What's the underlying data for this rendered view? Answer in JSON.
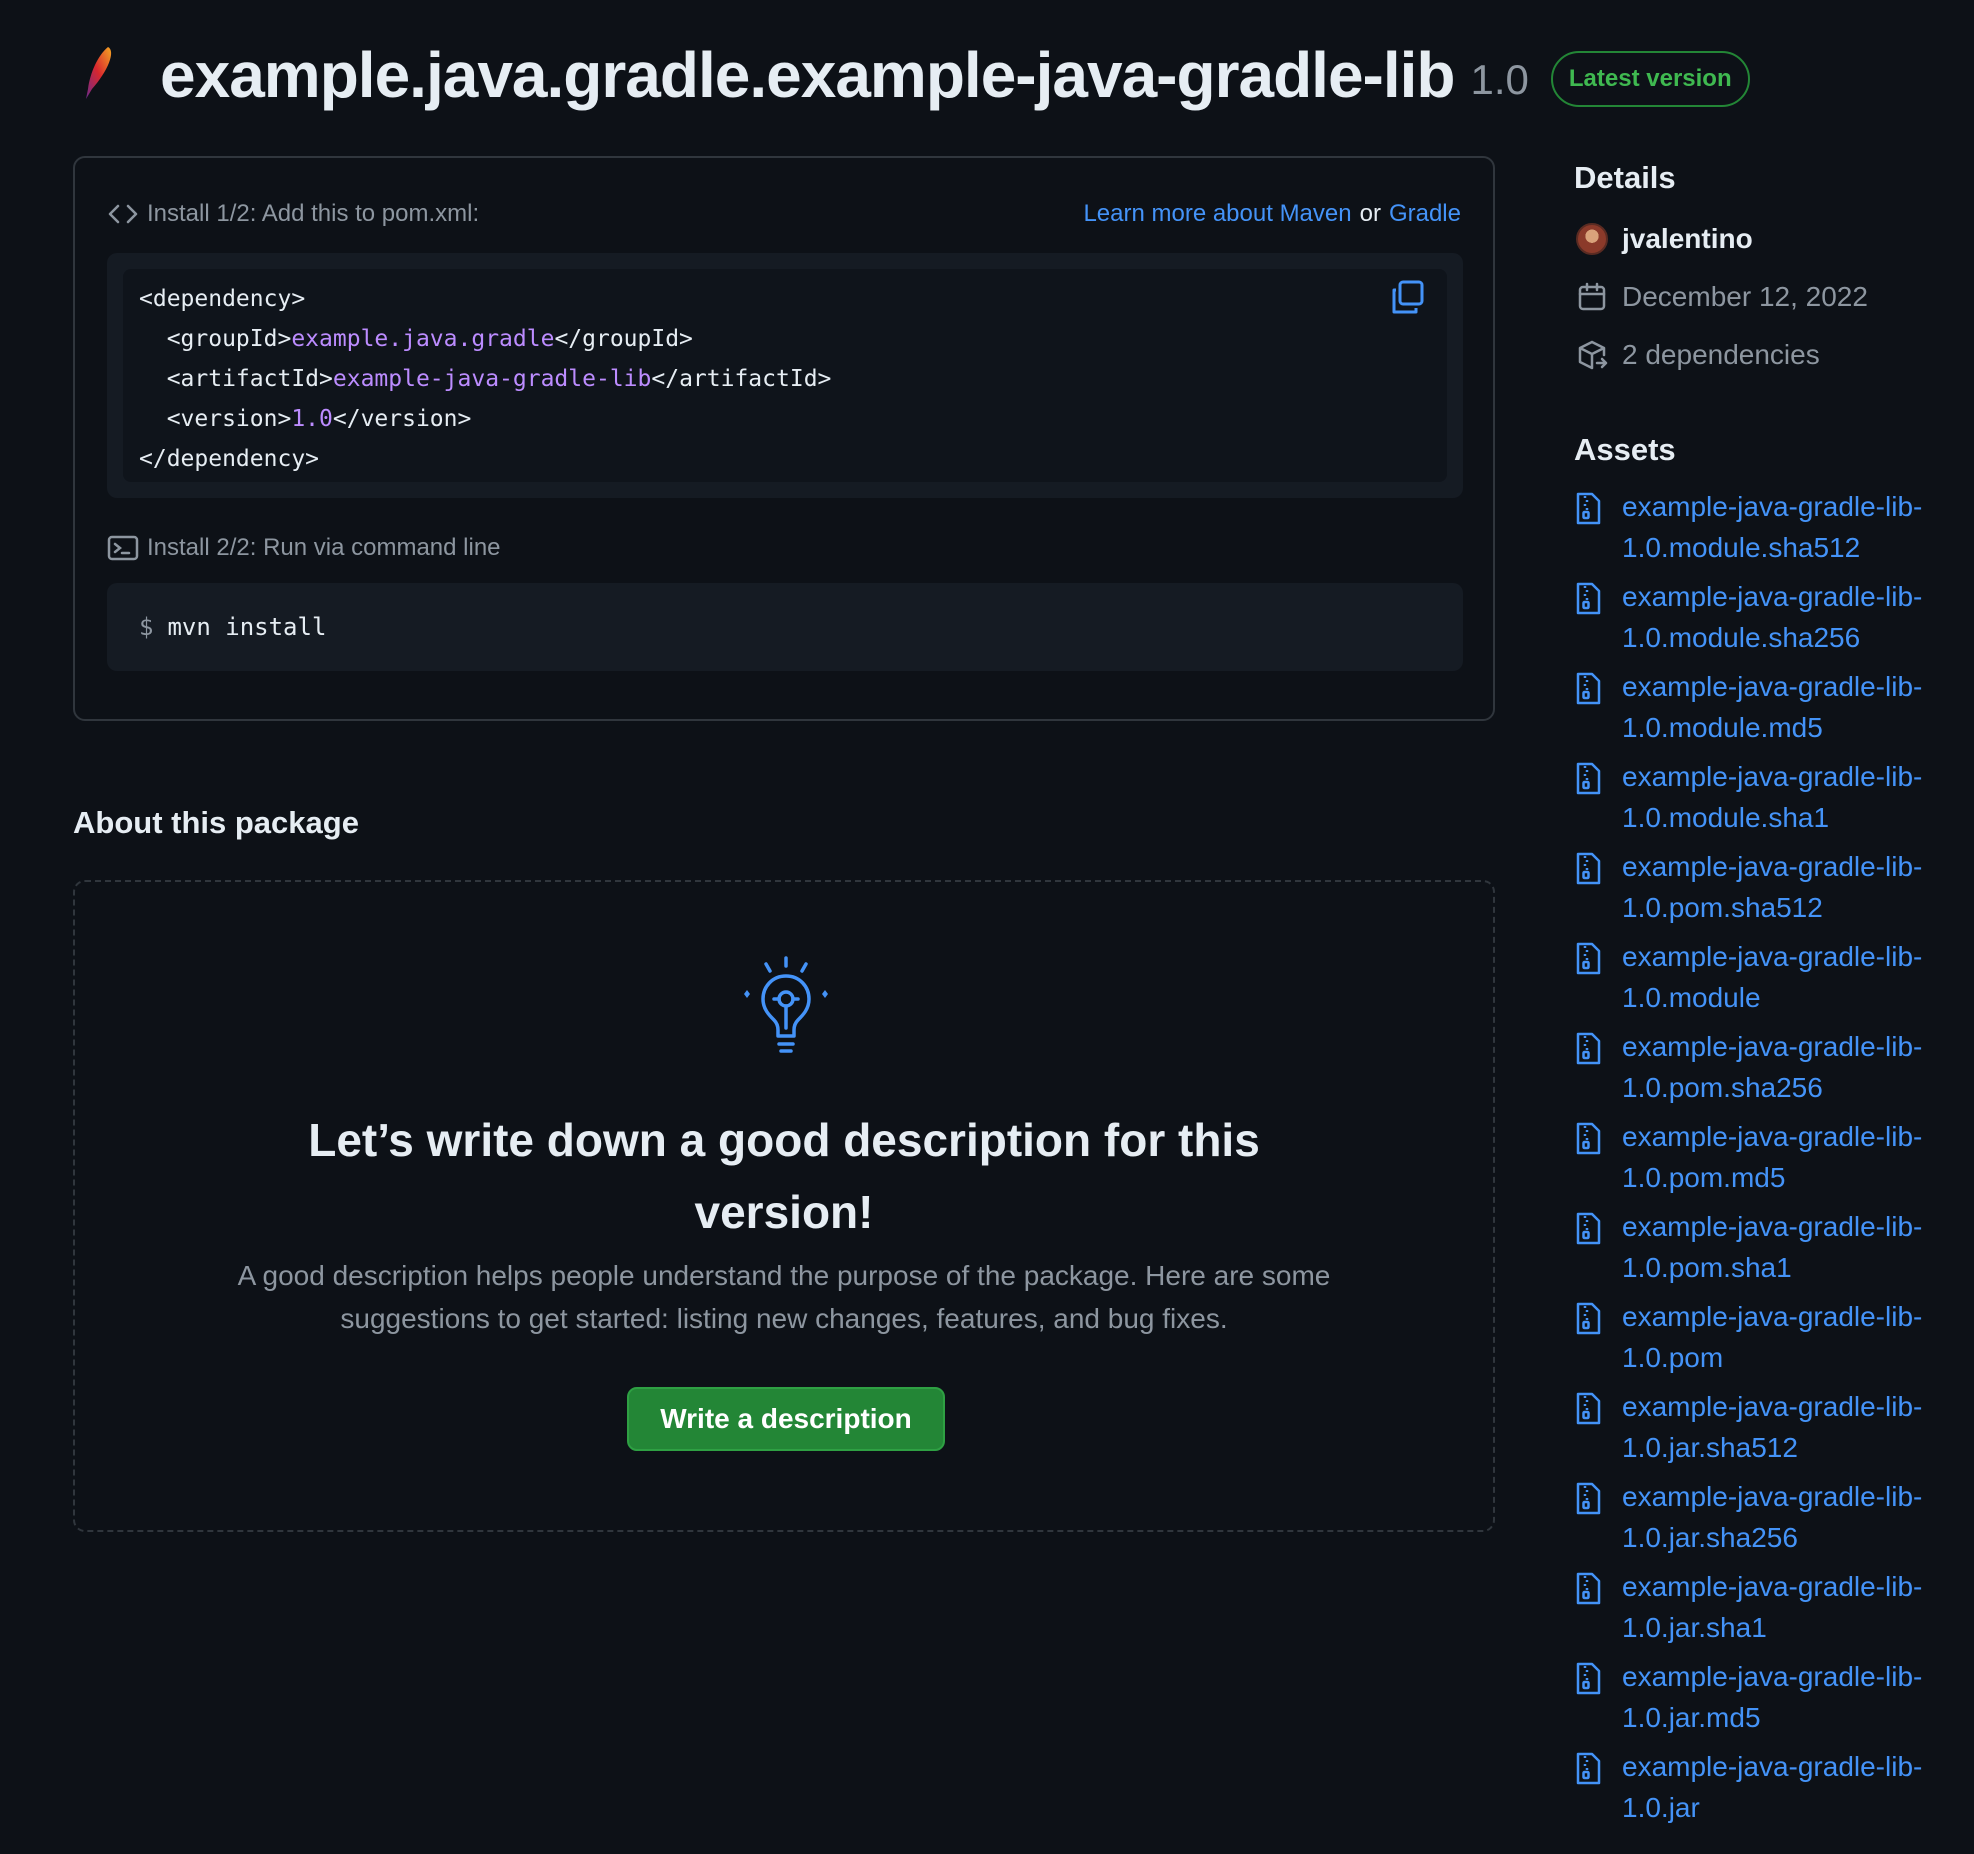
{
  "header": {
    "title": "example.java.gradle.example-java-gradle-lib",
    "version": "1.0",
    "badge": "Latest version"
  },
  "install": {
    "step1_label": "Install 1/2: Add this to pom.xml:",
    "learn_more": "Learn more about Maven",
    "or": "or",
    "gradle": "Gradle",
    "code": {
      "line1": "<dependency>",
      "group_open": "  <groupId>",
      "group_val": "example.java.gradle",
      "group_close": "</groupId>",
      "artifact_open": "  <artifactId>",
      "artifact_val": "example-java-gradle-lib",
      "artifact_close": "</artifactId>",
      "version_open": "  <version>",
      "version_val": "1.0",
      "version_close": "</version>",
      "line5": "</dependency>"
    },
    "step2_label": "Install 2/2: Run via command line",
    "prompt": "$",
    "command": "mvn install"
  },
  "about": {
    "title": "About this package",
    "empty_title": "Let’s write down a good description for this version!",
    "empty_desc": "A good description helps people understand the purpose of the package. Here are some suggestions to get started: listing new changes, features, and bug fixes.",
    "button": "Write a description"
  },
  "details": {
    "title": "Details",
    "user": "jvalentino",
    "date": "December 12, 2022",
    "dependencies": "2 dependencies"
  },
  "assets": {
    "title": "Assets",
    "items": [
      "example-java-gradle-lib-1.0.module.sha512",
      "example-java-gradle-lib-1.0.module.sha256",
      "example-java-gradle-lib-1.0.module.md5",
      "example-java-gradle-lib-1.0.module.sha1",
      "example-java-gradle-lib-1.0.pom.sha512",
      "example-java-gradle-lib-1.0.module",
      "example-java-gradle-lib-1.0.pom.sha256",
      "example-java-gradle-lib-1.0.pom.md5",
      "example-java-gradle-lib-1.0.pom.sha1",
      "example-java-gradle-lib-1.0.pom",
      "example-java-gradle-lib-1.0.jar.sha512",
      "example-java-gradle-lib-1.0.jar.sha256",
      "example-java-gradle-lib-1.0.jar.sha1",
      "example-java-gradle-lib-1.0.jar.md5",
      "example-java-gradle-lib-1.0.jar"
    ]
  },
  "colors": {
    "background": "#0d1117",
    "link": "#4493f8",
    "accent_green": "#238636",
    "code_value": "#bc8cff"
  }
}
